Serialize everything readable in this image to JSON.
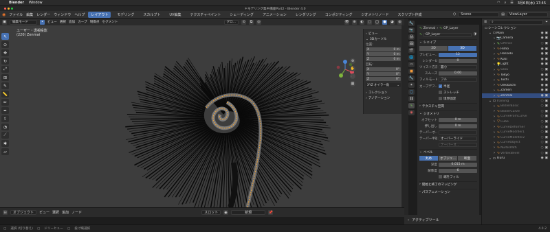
{
  "mac": {
    "app": "Blender",
    "window": "Window",
    "date": "3月6日(水)  17:45"
  },
  "window_title": "＊モデリング集中講座Part2 - Blender 4.0",
  "menu": {
    "items": [
      "ファイル",
      "編集",
      "レンダー",
      "ウィンドウ",
      "ヘルプ"
    ],
    "workspaces": [
      "レイアウト",
      "モデリング",
      "スカルプト",
      "UV編集",
      "テクスチャペイント",
      "シェーディング",
      "アニメーション",
      "レンダリング",
      "コンポジティング",
      "ジオメトリノード",
      "スクリプト作成"
    ],
    "active_workspace": "レイアウト",
    "scene": "Scene",
    "view_layer": "ViewLayer"
  },
  "viewport_header": {
    "mode": "編集モード",
    "menus": [
      "ビュー",
      "選択",
      "追加",
      "カーブ",
      "制御点",
      "セグメント"
    ],
    "orientation": "グロ..."
  },
  "viewport": {
    "view_name": "ユーザー・透視投影",
    "object_info": "(220) Zenmai"
  },
  "sidebar": {
    "view_label": "ビュー",
    "cursor_label": "3Dカーソル",
    "location_label": "位置:",
    "loc": [
      {
        "axis": "X",
        "value": "0 m"
      },
      {
        "axis": "Y",
        "value": "0 m"
      },
      {
        "axis": "Z",
        "value": "0 m"
      }
    ],
    "rotation_label": "回転:",
    "rot": [
      {
        "axis": "X",
        "value": "0°"
      },
      {
        "axis": "Y",
        "value": "0°"
      },
      {
        "axis": "Z",
        "value": "0°"
      }
    ],
    "rotation_mode": "XYZ オイラー角",
    "collection_label": "コレクション",
    "annotation_label": "アノテーション"
  },
  "properties": {
    "object_name": "Zenmai",
    "data_name": "GP_Layer",
    "datablock": "GP_Layer",
    "shape_section": "シェイプ",
    "dim_options": [
      "2D",
      "3D"
    ],
    "dim_active": "3D",
    "preview_label": "プレビュー...",
    "preview_value": "12",
    "render_label": "レンダーU",
    "render_value": "0",
    "twist_label": "ツイスト方法",
    "twist_value": "最小",
    "smooth_label": "スムーズ",
    "smooth_value": "0.00",
    "fill_label": "フィルモード",
    "fill_value": "フル",
    "curve_def_label": "カーブデフ...",
    "radius_label": "半径",
    "stretch_label": "ストレッチ",
    "bounds_label": "境界固定",
    "texture_section": "テクスチャ空間",
    "geometry_section": "ジオメトリ",
    "offset_label": "オフセット",
    "offset_value": "0 m",
    "extrude_label": "押し出し",
    "extrude_value": "0 m",
    "taper_label": "テーパーオ...",
    "taper_mode_label": "テーパー半径",
    "taper_mode_value": "オーバーライド",
    "taper_obj_placeholder": "テーパーオ...",
    "bevel_section": "ベベル",
    "bevel_modes": [
      "丸め",
      "オブジェ...",
      "断面"
    ],
    "bevel_active": "丸め",
    "depth_label": "深度",
    "depth_value": "0.015 m",
    "resolution_label": "解像度",
    "resolution_value": "6",
    "fill_caps_label": "端をフィル",
    "mapping_section": "開始と終了のマッピング",
    "path_anim_section": "パスアニメーション",
    "active_tool": "アクティブツール"
  },
  "outliner": {
    "title": "シーンコレクション",
    "items": [
      {
        "name": "Main",
        "depth": 1,
        "icon": "collection",
        "dim": false,
        "sel": false
      },
      {
        "name": "Camera",
        "depth": 2,
        "icon": "camera",
        "dim": false,
        "sel": false
      },
      {
        "name": "GPencil",
        "depth": 2,
        "icon": "gpencil",
        "dim": true,
        "sel": false
      },
      {
        "name": "Himo",
        "depth": 2,
        "icon": "curve",
        "dim": false,
        "sel": false
      },
      {
        "name": "Hosseki",
        "depth": 2,
        "icon": "curve",
        "dim": false,
        "sel": false
      },
      {
        "name": "Kuki",
        "depth": 2,
        "icon": "curve",
        "dim": false,
        "sel": false
      },
      {
        "name": "Light",
        "depth": 2,
        "icon": "light",
        "dim": false,
        "sel": false
      },
      {
        "name": "Saku",
        "depth": 2,
        "icon": "curve",
        "dim": true,
        "sel": false
      },
      {
        "name": "Tokyo",
        "depth": 2,
        "icon": "curve",
        "dim": false,
        "sel": false
      },
      {
        "name": "Tuchi",
        "depth": 2,
        "icon": "curve",
        "dim": false,
        "sel": false
      },
      {
        "name": "Uekibachi",
        "depth": 2,
        "icon": "curve",
        "dim": false,
        "sel": false
      },
      {
        "name": "Zamen",
        "depth": 2,
        "icon": "curve",
        "dim": false,
        "sel": false
      },
      {
        "name": "Zenmai",
        "depth": 2,
        "icon": "curve",
        "dim": false,
        "sel": true
      },
      {
        "name": "Training",
        "depth": 1,
        "icon": "collection",
        "dim": true,
        "sel": false
      },
      {
        "name": "BezierBasic",
        "depth": 2,
        "icon": "curve",
        "dim": true,
        "sel": false
      },
      {
        "name": "BezierCurve",
        "depth": 2,
        "icon": "curve",
        "dim": true,
        "sel": false
      },
      {
        "name": "CurveFromCurve",
        "depth": 2,
        "icon": "curve",
        "dim": true,
        "sel": false
      },
      {
        "name": "Cube",
        "depth": 2,
        "icon": "mesh",
        "dim": true,
        "sel": false
      },
      {
        "name": "CurveDeformer",
        "depth": 2,
        "icon": "curve",
        "dim": true,
        "sel": false
      },
      {
        "name": "CurveModifier1",
        "depth": 2,
        "icon": "curve",
        "dim": true,
        "sel": false
      },
      {
        "name": "CurveModifier2",
        "depth": 2,
        "icon": "curve",
        "dim": true,
        "sel": false
      },
      {
        "name": "CurveObject",
        "depth": 2,
        "icon": "curve",
        "dim": true,
        "sel": false
      },
      {
        "name": "NurbsPath",
        "depth": 2,
        "icon": "curve",
        "dim": true,
        "sel": false
      },
      {
        "name": "VertexBevel",
        "depth": 2,
        "icon": "curve",
        "dim": true,
        "sel": false
      },
      {
        "name": "Tsuru",
        "depth": 1,
        "icon": "collection",
        "dim": false,
        "sel": false
      }
    ]
  },
  "timeline": {
    "mode": "オブジェクト",
    "menus": [
      "ビュー",
      "選択",
      "追加",
      "ノード"
    ],
    "slot": "スロット",
    "new_btn": "新規"
  },
  "status": {
    "select": "選択 (切り替え)",
    "pan": "ドリーヒュー",
    "lasso": "投げ縄選択",
    "version": "4.0.2"
  },
  "colors": {
    "accent": "#4772b3",
    "selected_row": "#334d80",
    "viewport_bg": "#3d3d3d",
    "highlight": "#f2a233"
  }
}
